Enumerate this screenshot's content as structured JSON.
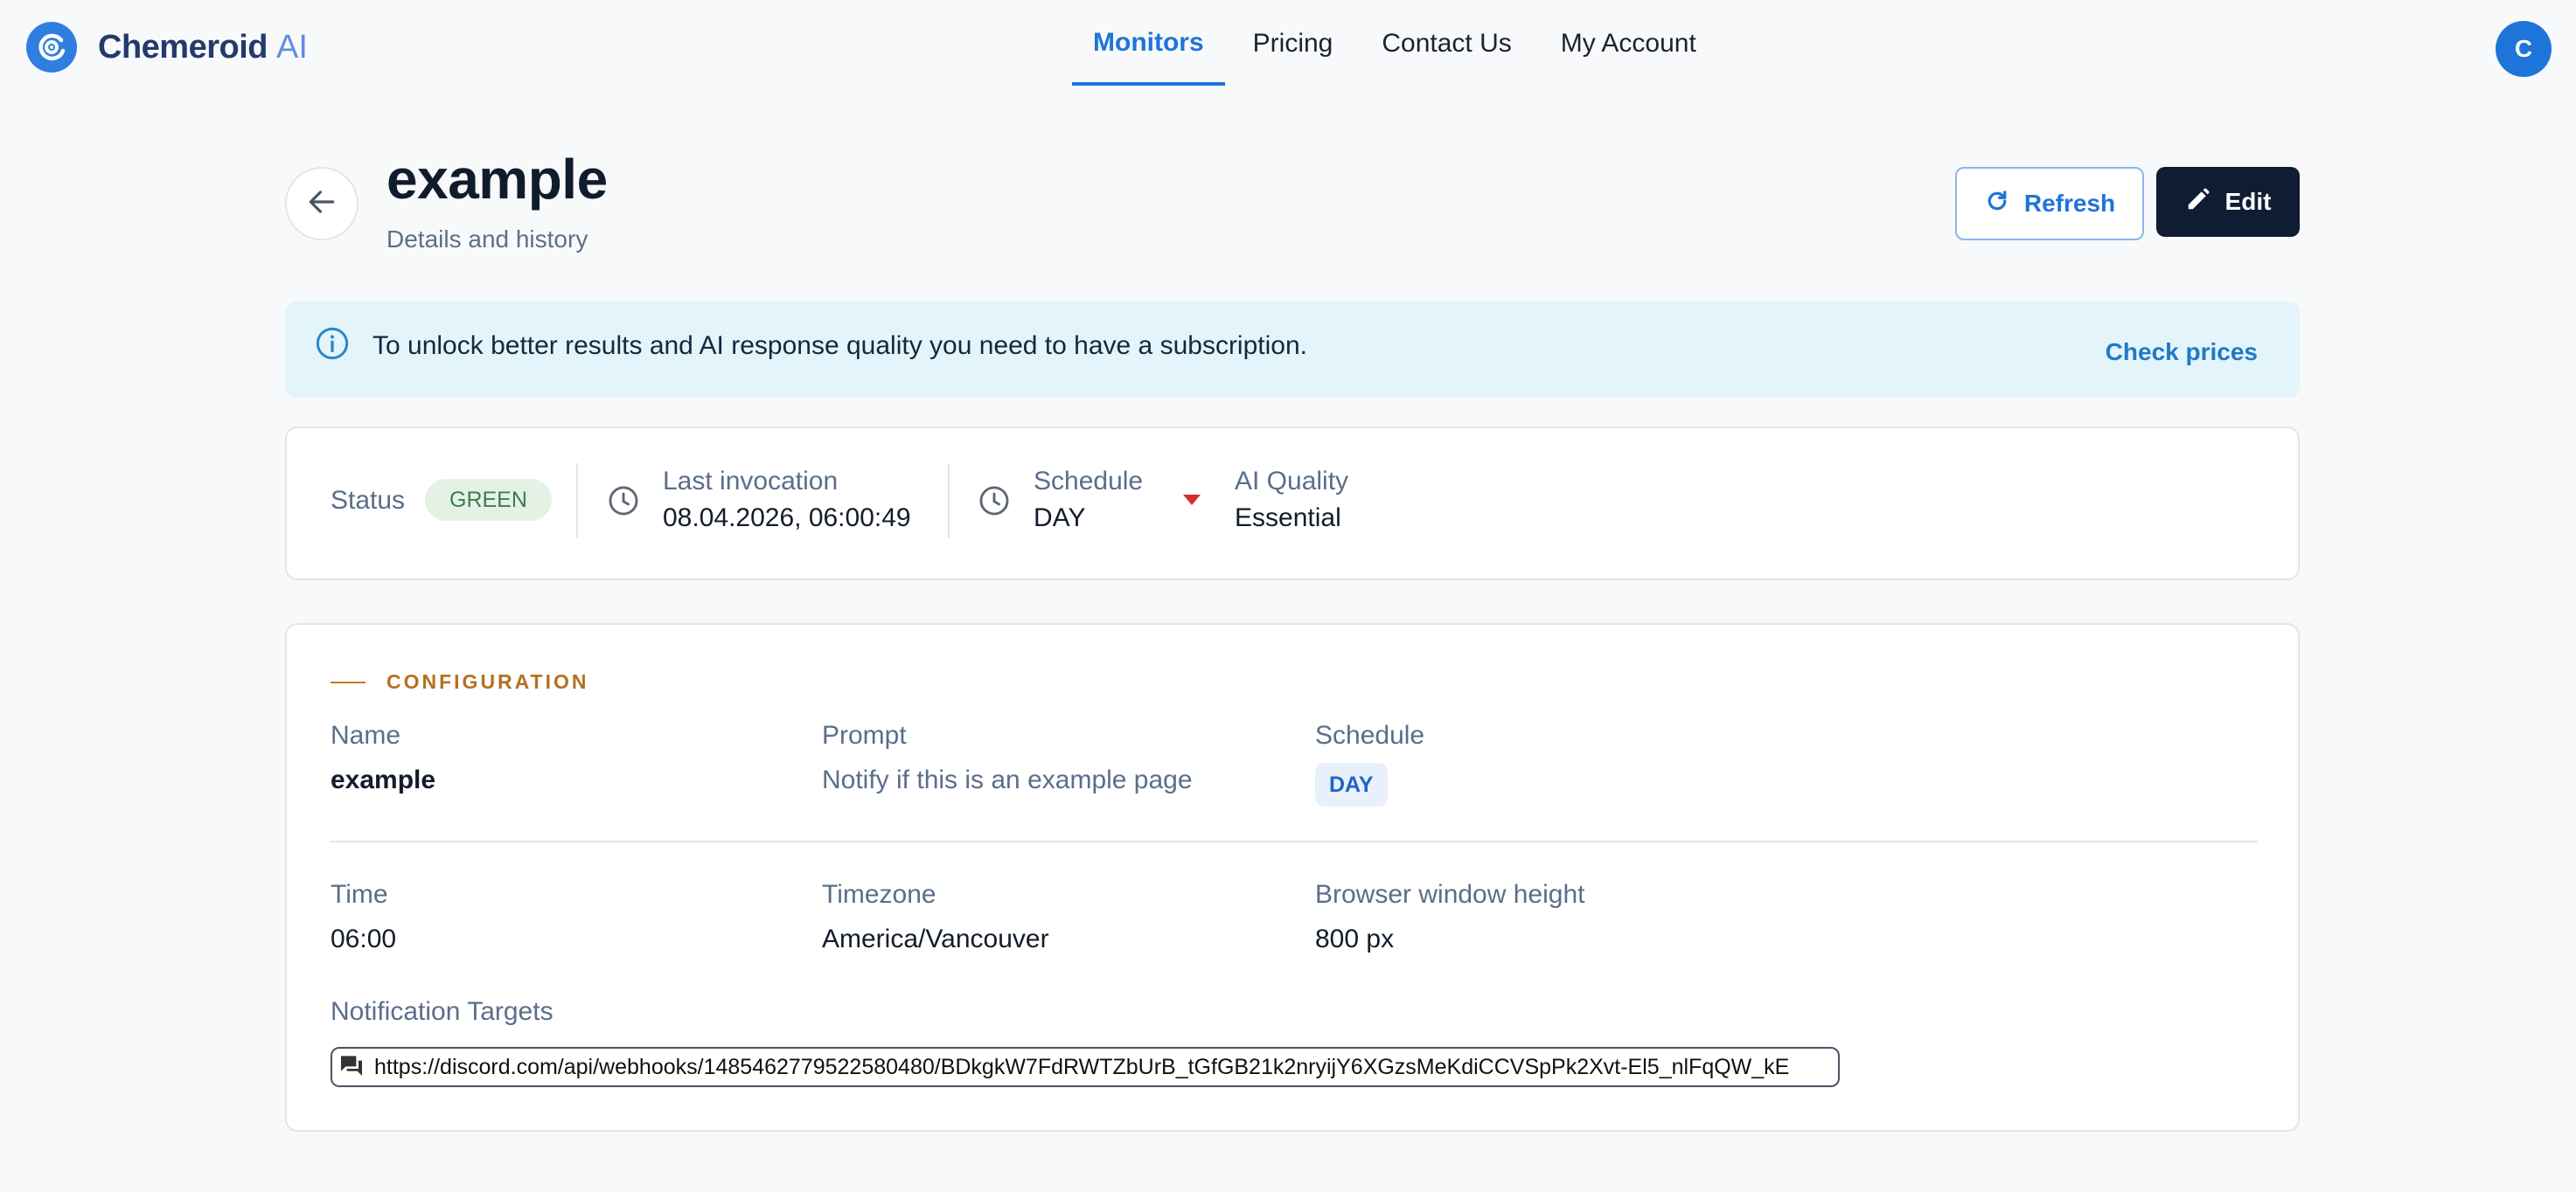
{
  "header": {
    "brand_name": "Chemeroid",
    "brand_suffix": "AI",
    "nav": [
      "Monitors",
      "Pricing",
      "Contact Us",
      "My Account"
    ],
    "active_nav": "Monitors",
    "avatar_initial": "C"
  },
  "page": {
    "title": "example",
    "subtitle": "Details and history",
    "refresh_label": "Refresh",
    "edit_label": "Edit"
  },
  "banner": {
    "text": "To unlock better results and AI response quality you need to have a subscription.",
    "link": "Check prices"
  },
  "status": {
    "status_label": "Status",
    "status_value": "GREEN",
    "last_invocation_label": "Last invocation",
    "last_invocation_value": "08.04.2026, 06:00:49",
    "schedule_label": "Schedule",
    "schedule_value": "DAY",
    "ai_quality_label": "AI Quality",
    "ai_quality_value": "Essential"
  },
  "config": {
    "section_title": "CONFIGURATION",
    "name_label": "Name",
    "name_value": "example",
    "prompt_label": "Prompt",
    "prompt_value": "Notify if this is an example page",
    "schedule_label": "Schedule",
    "schedule_value": "DAY",
    "time_label": "Time",
    "time_value": "06:00",
    "timezone_label": "Timezone",
    "timezone_value": "America/Vancouver",
    "browser_height_label": "Browser window height",
    "browser_height_value": "800 px",
    "targets_label": "Notification Targets",
    "targets": [
      "https://discord.com/api/webhooks/1485462779522580480/BDkgkW7FdRWTZbUrB_tGfGB21k2nryijY6XGzsMeKdiCCVSpPk2Xvt-El5_nlFqQW_kE"
    ]
  },
  "icons": {
    "brand": "logo-icon",
    "back": "arrow-left-icon",
    "refresh": "refresh-icon",
    "edit": "pencil-icon",
    "info": "info-icon",
    "clock": "clock-icon",
    "caret": "caret-down-icon",
    "chat": "chat-icon"
  },
  "colors": {
    "accent": "#1e74d9",
    "dark_button": "#0f1c33",
    "banner_bg": "#e3f4fa",
    "status_green_bg": "#e4f2e6",
    "section_orange": "#b5701f",
    "caret_red": "#d4302b"
  }
}
